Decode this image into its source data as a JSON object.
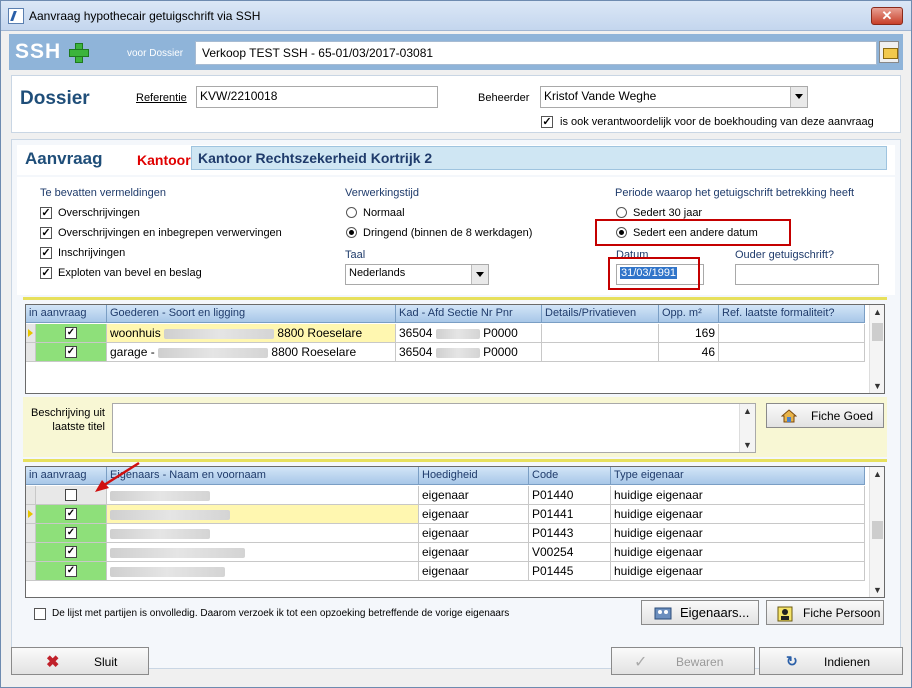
{
  "window": {
    "title": "Aanvraag hypothecair getuigschrift via SSH",
    "close_label": "✕"
  },
  "header": {
    "logo": "SSH",
    "voor_dossier_label": "voor Dossier",
    "dossier_value": "Verkoop TEST SSH - 65-01/03/2017-03081"
  },
  "dossier": {
    "heading": "Dossier",
    "referentie_label": "Referentie",
    "referentie_value": "KVW/2210018",
    "beheerder_label": "Beheerder",
    "beheerder_value": "Kristof Vande Weghe",
    "boekhouding_label": "is ook verantwoordelijk voor de boekhouding van deze aanvraag",
    "boekhouding_checked": true
  },
  "aanvraag": {
    "heading": "Aanvraag",
    "kantoor_label": "Kantoor",
    "kantoor_value": "Kantoor Rechtszekerheid Kortrijk 2",
    "vermeldingen_title": "Te bevatten vermeldingen",
    "vermeldingen": [
      {
        "label": "Overschrijvingen",
        "checked": true
      },
      {
        "label": "Overschrijvingen en inbegrepen verwervingen",
        "checked": true
      },
      {
        "label": "Inschrijvingen",
        "checked": true
      },
      {
        "label": "Exploten van bevel en beslag",
        "checked": true
      }
    ],
    "verwerkingstijd_title": "Verwerkingstijd",
    "verwerking_options": [
      {
        "label": "Normaal",
        "selected": false
      },
      {
        "label": "Dringend (binnen de 8 werkdagen)",
        "selected": true
      }
    ],
    "taal_label": "Taal",
    "taal_value": "Nederlands",
    "periode_title": "Periode waarop het getuigschrift betrekking heeft",
    "periode_options": [
      {
        "label": "Sedert 30 jaar",
        "selected": false
      },
      {
        "label": "Sedert een andere datum",
        "selected": true
      }
    ],
    "datum_label": "Datum",
    "datum_value": "31/03/1991",
    "ouder_label": "Ouder getuigschrift?",
    "ouder_value": ""
  },
  "goederen_grid": {
    "headers": [
      "in aanvraag",
      "Goederen - Soort en ligging",
      "Kad - Afd Sectie Nr Pnr",
      "Details/Privatieven",
      "Opp. m²",
      "Ref. laatste formaliteit?"
    ],
    "rows": [
      {
        "checked": true,
        "soort": "woonhuis",
        "plaats": "8800 Roeselare",
        "kad_a": "36504",
        "kad_b": "P0000",
        "details": "",
        "opp": "169",
        "ref": "",
        "selected": true
      },
      {
        "checked": true,
        "soort": "garage  -",
        "plaats": "8800 Roeselare",
        "kad_a": "36504",
        "kad_b": "P0000",
        "details": "",
        "opp": "46",
        "ref": "",
        "selected": false
      }
    ]
  },
  "beschrijving": {
    "label_line1": "Beschrijving uit",
    "label_line2": "laatste titel",
    "value": "",
    "fiche_goed_label": "Fiche Goed"
  },
  "eigenaars_grid": {
    "headers": [
      "in aanvraag",
      "Eigenaars - Naam en voornaam",
      "Hoedigheid",
      "Code",
      "Type eigenaar"
    ],
    "rows": [
      {
        "checked": false,
        "hoedigheid": "eigenaar",
        "code": "P01440",
        "type": "huidige eigenaar",
        "selected": false
      },
      {
        "checked": true,
        "hoedigheid": "eigenaar",
        "code": "P01441",
        "type": "huidige eigenaar",
        "selected": true
      },
      {
        "checked": true,
        "hoedigheid": "eigenaar",
        "code": "P01443",
        "type": "huidige eigenaar",
        "selected": false
      },
      {
        "checked": true,
        "hoedigheid": "eigenaar",
        "code": "V00254",
        "type": "huidige eigenaar",
        "selected": false
      },
      {
        "checked": true,
        "hoedigheid": "eigenaar",
        "code": "P01445",
        "type": "huidige eigenaar",
        "selected": false
      }
    ]
  },
  "footer": {
    "onvolledig_label": "De lijst met partijen is onvolledig. Daarom verzoek ik tot een opzoeking betreffende de vorige eigenaars",
    "eigenaars_button": "Eigenaars...",
    "fiche_persoon_button": "Fiche Persoon",
    "sluit_button": "Sluit",
    "bewaren_button": "Bewaren",
    "indienen_button": "Indienen"
  },
  "colors": {
    "header_band": "#8fb4d9",
    "kantoor_red": "#e00000",
    "highlight_red": "#c40000",
    "grid_selected_row": "#fff7b0",
    "grid_check_green": "#8ee07a"
  }
}
